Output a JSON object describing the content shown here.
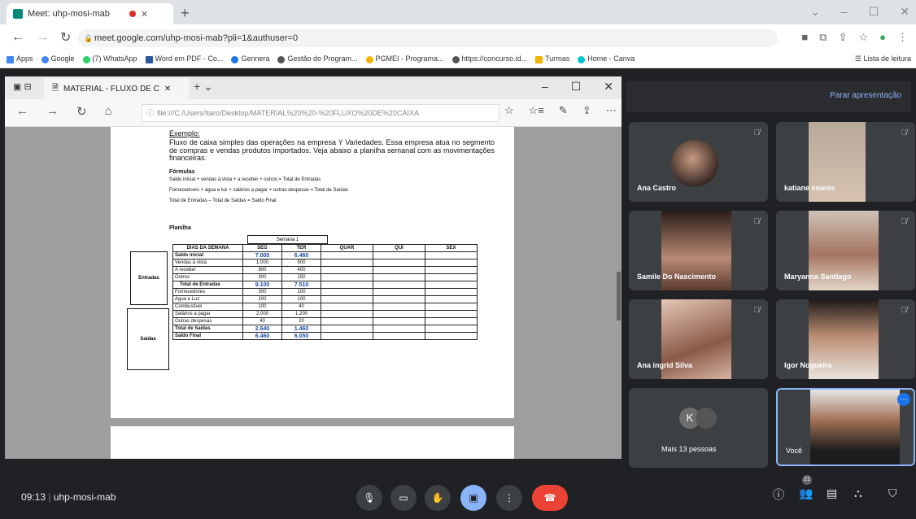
{
  "browser": {
    "tab_title": "Meet: uhp-mosi-mab",
    "new_tab": "+",
    "url": "meet.google.com/uhp-mosi-mab?pli=1&authuser=0",
    "bookmarks": [
      "Apps",
      "Google",
      "(7) WhatsApp",
      "Word em PDF - Co...",
      "Gennera",
      "Gestão do Program...",
      "PGMEI - Programa...",
      "https://concurso.id...",
      "Turmas",
      "Home - Canva"
    ],
    "reading_list": "Lista de leitura"
  },
  "edge": {
    "tab_title": "MATERIAL - FLUXO DE C",
    "url": "file:///C:/Users/Itaro/Desktop/MATERIAL%20%20-%20FLUXO%20DE%20CAIXA"
  },
  "document": {
    "example_heading": "Exemplo:",
    "example_body": "Fluxo de caixa simples das operações na empresa Y Variedades. Essa empresa atua no segmento de compras e vendas produtos importados. Veja abaixo a planilha semanal com as movimentações financeiras.",
    "formulas_heading": "Fórmulas",
    "formulas": [
      "Saldo inicial + vendas à vista + a receber + outros = Total de Entradas",
      "Fornecedores + água e luz + salários a pagar + outras despesas = Total de Saídas",
      "Total de Entradas – Total de Saídas = Saldo Final"
    ],
    "planilha_heading": "Planilha",
    "week_label": "Semana 1",
    "group_entradas": "Entradas",
    "group_saidas": "Saídas",
    "columns": [
      "DIAS DA SEMANA",
      "SEG",
      "TER",
      "QUAR",
      "QUI",
      "SEX"
    ],
    "rows": [
      {
        "label": "Saldo inicial",
        "seg": "7.000",
        "ter": "6.460",
        "bold": true,
        "blue": true
      },
      {
        "label": "Vendas à vista",
        "seg": "1.000",
        "ter": "500"
      },
      {
        "label": "A receber",
        "seg": "800",
        "ter": "400"
      },
      {
        "label": "Outros",
        "seg": "300",
        "ter": "150"
      },
      {
        "label": "Total de Entradas",
        "seg": "9.100",
        "ter": "7.510",
        "bold": true,
        "blue": true
      },
      {
        "label": "Fornecedores",
        "seg": "300",
        "ter": "100"
      },
      {
        "label": "Água e Luz",
        "seg": "200",
        "ter": "100"
      },
      {
        "label": "Combustível",
        "seg": "100",
        "ter": "40"
      },
      {
        "label": "Salários a pagar",
        "seg": "2.000",
        "ter": "1.200"
      },
      {
        "label": "Outras despesas",
        "seg": "40",
        "ter": "20"
      },
      {
        "label": "Total de Saídas",
        "seg": "2.640",
        "ter": "1.460",
        "bold": true,
        "blue": true
      },
      {
        "label": "Saldo Final",
        "seg": "6.460",
        "ter": "6.050",
        "bold": true,
        "blue": true
      }
    ]
  },
  "meet": {
    "stop_presenting": "Parar apresentação",
    "participants": [
      "Ana Castro",
      "katiane soares",
      "Samile Do Nascimento",
      "Maryanna Santiago",
      "Ana ingrid Silva",
      "Igor Nogueira"
    ],
    "more_initial": "K",
    "more_label": "Mais 13 pessoas",
    "you_label": "Você",
    "time": "09:13",
    "meeting_code": "uhp-mosi-mab",
    "people_count": "21"
  }
}
